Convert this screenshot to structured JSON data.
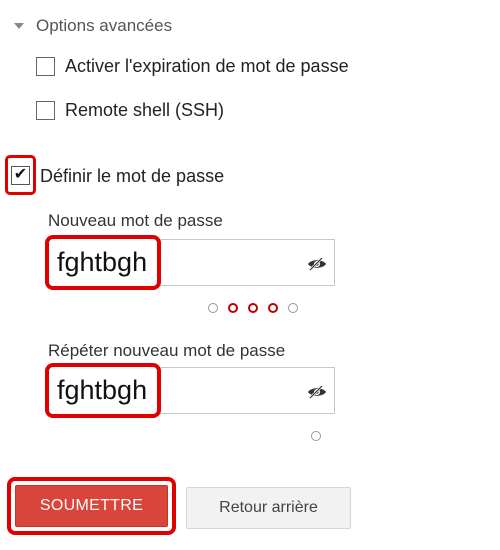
{
  "advanced_options": {
    "label": "Options avancées",
    "items": [
      {
        "label": "Activer l'expiration de mot de passe",
        "checked": false
      },
      {
        "label": "Remote shell (SSH)",
        "checked": false
      }
    ]
  },
  "define_password": {
    "label": "Définir le mot de passe",
    "checked": true,
    "check_glyph": "✔"
  },
  "new_password": {
    "label": "Nouveau mot de passe",
    "value": "fghtbgh",
    "icon": "eye-slash-icon",
    "strength_dots": [
      false,
      true,
      true,
      true,
      false
    ]
  },
  "repeat_password": {
    "label": "Répéter nouveau mot de passe",
    "value": "fghtbgh",
    "icon": "eye-slash-icon",
    "strength_dots": [
      false
    ]
  },
  "buttons": {
    "submit_label": "SOUMETTRE",
    "back_label": "Retour arrière"
  },
  "colors": {
    "highlight": "#e00000",
    "submit_bg": "#d9453a",
    "strength_active": "#c00000",
    "strength_inactive": "#999999"
  }
}
